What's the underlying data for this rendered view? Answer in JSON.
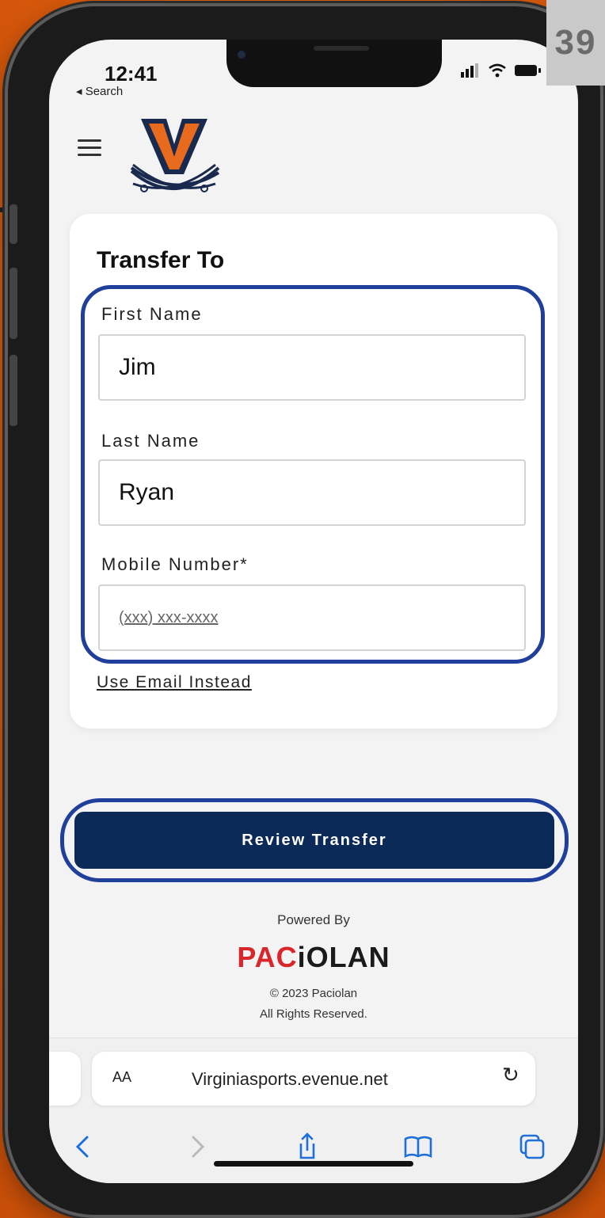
{
  "badge": {
    "page_number": "39"
  },
  "status": {
    "time": "12:41",
    "back_label": "◂ Search"
  },
  "header": {
    "menu_icon": "hamburger-icon",
    "logo_icon": "virginia-cavaliers-logo"
  },
  "form": {
    "title": "Transfer To",
    "first_name": {
      "label": "First Name",
      "value": "Jim"
    },
    "last_name": {
      "label": "Last Name",
      "value": "Ryan"
    },
    "mobile": {
      "label": "Mobile Number*",
      "placeholder": "(xxx) xxx-xxxx"
    },
    "alt_link": "Use Email Instead"
  },
  "action": {
    "review_label": "Review Transfer"
  },
  "footer": {
    "powered_by": "Powered By",
    "brand_part1": "PAC",
    "brand_part2": "iOLAN",
    "copyright": "© 2023 Paciolan",
    "rights": "All Rights Reserved."
  },
  "browser": {
    "aa_label": "AA",
    "url": "Virginiasports.evenue.net",
    "reload_icon": "reload-icon",
    "toolbar": [
      "back-icon",
      "forward-icon",
      "share-icon",
      "bookmarks-icon",
      "tabs-icon"
    ]
  },
  "colors": {
    "accent": "#0c2a57",
    "highlight": "#1f3f9a",
    "brand_red": "#d9262b",
    "background": "#e8620e"
  }
}
